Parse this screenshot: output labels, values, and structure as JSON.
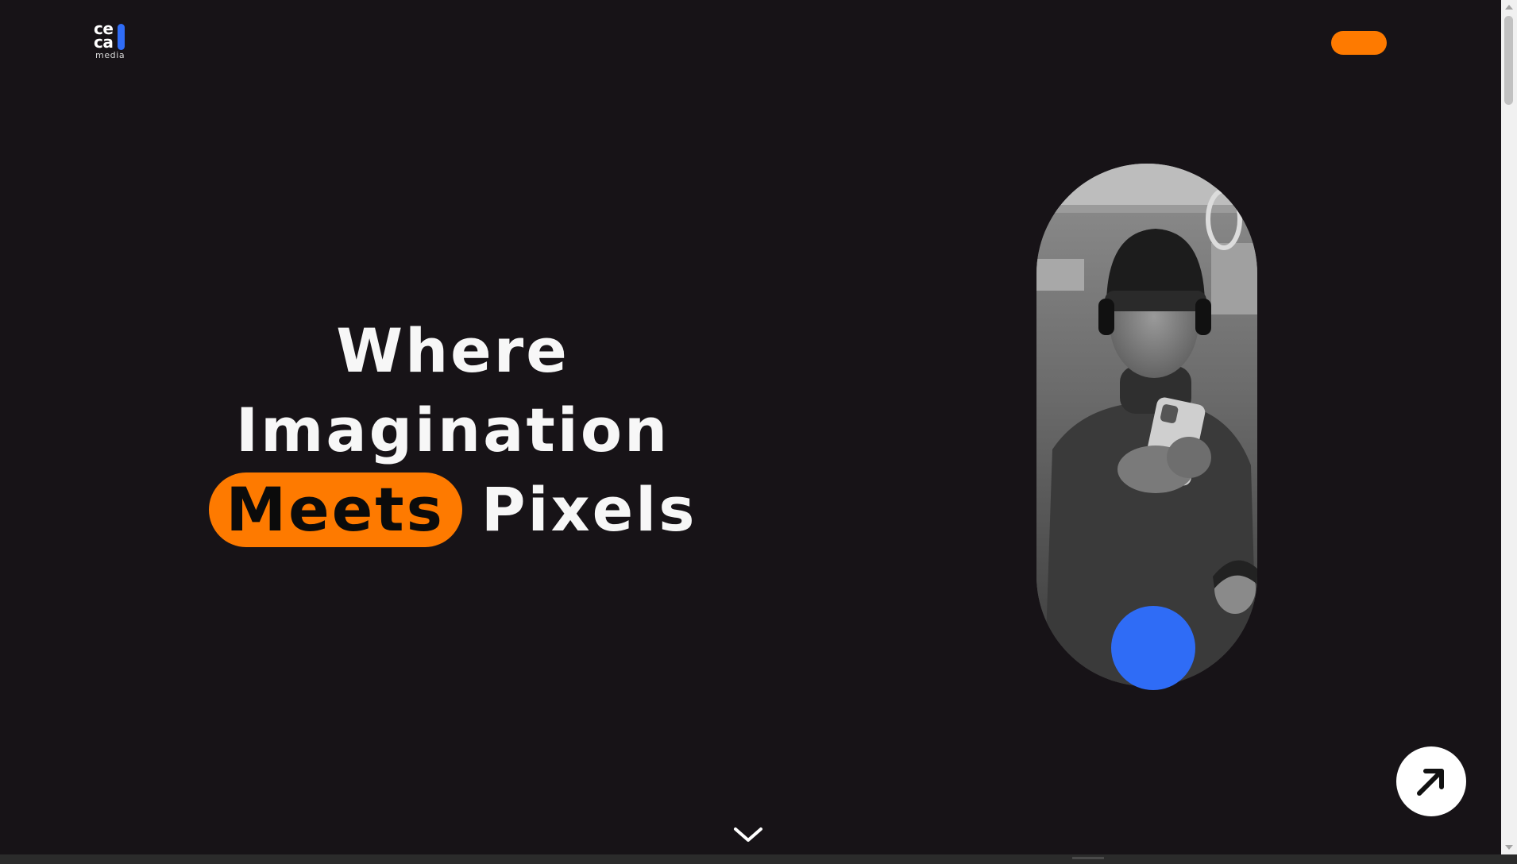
{
  "header": {
    "logo": {
      "line1": "ce",
      "line2": "ca",
      "sub": "media",
      "accent_color": "#2f6cf6"
    },
    "cta_color": "#fe7a00"
  },
  "hero": {
    "line1": "Where",
    "line2": "Imagination",
    "highlight": "Meets",
    "line3_rest": "Pixels",
    "highlight_color": "#fe7a00",
    "photo_icon": "person-with-phone-photo",
    "dot_color": "#2f6cf6"
  },
  "floating_button": {
    "icon": "arrow-up-right-icon"
  },
  "scroll_hint": {
    "icon": "chevron-down-icon"
  },
  "colors": {
    "background": "#171317",
    "text": "#f7f7f7",
    "accent_orange": "#fe7a00",
    "accent_blue": "#2f6cf6"
  }
}
